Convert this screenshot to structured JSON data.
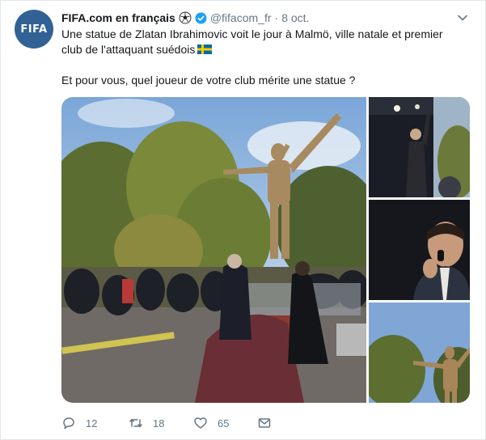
{
  "tweet": {
    "avatar_text": "FIFA",
    "author_name": "FIFA.com en français",
    "handle": "@fifacom_fr",
    "separator": "·",
    "date": "8 oct.",
    "text_line1": "Une statue de Zlatan Ibrahimovic voit le jour à Malmö, ville natale et premier club de l'attaquant suédois",
    "text_line2": "Et pour vous, quel joueur de votre club mérite une statue ?"
  },
  "actions": {
    "reply_count": "12",
    "retweet_count": "18",
    "like_count": "65"
  },
  "icons": {
    "avatar": "fifa-logo",
    "ball": "soccer-ball-icon",
    "verified": "verified-badge-icon",
    "chevron": "chevron-down-icon",
    "flag": "sweden-flag-icon",
    "reply": "reply-icon",
    "retweet": "retweet-icon",
    "like": "heart-icon",
    "dm": "envelope-icon"
  },
  "colors": {
    "link_blue": "#1da1f2",
    "secondary_text": "#657786",
    "fifa_blue": "#326295"
  }
}
